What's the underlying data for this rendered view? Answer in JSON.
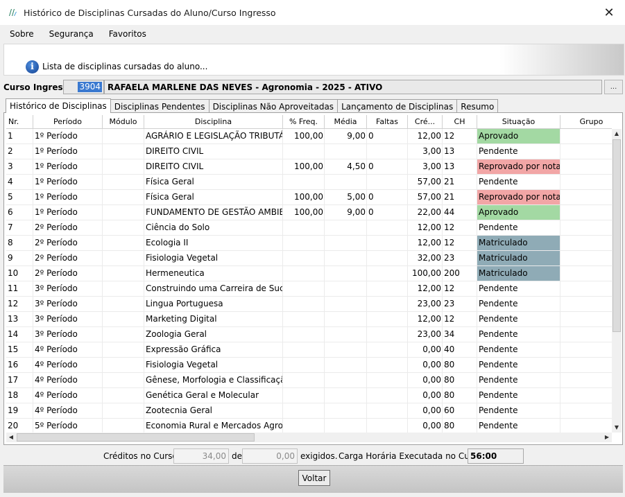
{
  "window": {
    "title": "Histórico de Disciplinas Cursadas do Aluno/Curso Ingresso",
    "close_symbol": "✕"
  },
  "menu": [
    "Sobre",
    "Segurança",
    "Favoritos"
  ],
  "info": {
    "icon_letter": "i",
    "text": "Lista de disciplinas cursadas do aluno..."
  },
  "curso": {
    "label": "Curso Ingresso:",
    "code": "3904",
    "name": "RAFAELA MARLENE DAS NEVES - Agronomia - 2025 - ATIVO",
    "lookup_label": "..."
  },
  "tabs": [
    "Histórico de Disciplinas",
    "Disciplinas Pendentes",
    "Disciplinas Não Aproveitadas",
    "Lançamento de Disciplinas",
    "Resumo"
  ],
  "grid": {
    "columns": [
      "Nr.",
      "Período",
      "Módulo",
      "Disciplina",
      "% Freq.",
      "Média",
      "Faltas",
      "Cré...",
      "CH",
      "Situação",
      "Grupo"
    ],
    "status_colors": {
      "Aprovado": "#a3d9a3",
      "Reprovado por nota": "#f2a6a6",
      "Matriculado": "#8fabb6",
      "Pendente": "#ffffff"
    },
    "rows": [
      {
        "nr": "1",
        "periodo": "1º Período",
        "modulo": "",
        "disciplina": "AGRÁRIO E LEGISLAÇÃO TRIBUTÁRIA",
        "freq": "100,00",
        "media": "9,00",
        "faltas": "0",
        "creditos": "12,00",
        "ch": "12",
        "situacao": "Aprovado",
        "grupo": ""
      },
      {
        "nr": "2",
        "periodo": "1º Período",
        "modulo": "",
        "disciplina": "DIREITO CIVIL",
        "freq": "",
        "media": "",
        "faltas": "",
        "creditos": "3,00",
        "ch": "13",
        "situacao": "Pendente",
        "grupo": ""
      },
      {
        "nr": "3",
        "periodo": "1º Período",
        "modulo": "",
        "disciplina": "DIREITO CIVIL",
        "freq": "100,00",
        "media": "4,50",
        "faltas": "0",
        "creditos": "3,00",
        "ch": "13",
        "situacao": "Reprovado por nota",
        "grupo": ""
      },
      {
        "nr": "4",
        "periodo": "1º Período",
        "modulo": "",
        "disciplina": "Física Geral",
        "freq": "",
        "media": "",
        "faltas": "",
        "creditos": "57,00",
        "ch": "21",
        "situacao": "Pendente",
        "grupo": ""
      },
      {
        "nr": "5",
        "periodo": "1º Período",
        "modulo": "",
        "disciplina": "Física Geral",
        "freq": "100,00",
        "media": "5,00",
        "faltas": "0",
        "creditos": "57,00",
        "ch": "21",
        "situacao": "Reprovado por nota",
        "grupo": ""
      },
      {
        "nr": "6",
        "periodo": "1º Período",
        "modulo": "",
        "disciplina": "FUNDAMENTO DE GESTÃO AMBIE...",
        "freq": "100,00",
        "media": "9,00",
        "faltas": "0",
        "creditos": "22,00",
        "ch": "44",
        "situacao": "Aprovado",
        "grupo": ""
      },
      {
        "nr": "7",
        "periodo": "2º Período",
        "modulo": "",
        "disciplina": "Ciência do Solo",
        "freq": "",
        "media": "",
        "faltas": "",
        "creditos": "12,00",
        "ch": "12",
        "situacao": "Pendente",
        "grupo": ""
      },
      {
        "nr": "8",
        "periodo": "2º Período",
        "modulo": "",
        "disciplina": "Ecologia II",
        "freq": "",
        "media": "",
        "faltas": "",
        "creditos": "12,00",
        "ch": "12",
        "situacao": "Matriculado",
        "grupo": ""
      },
      {
        "nr": "9",
        "periodo": "2º Período",
        "modulo": "",
        "disciplina": "Fisiologia Vegetal",
        "freq": "",
        "media": "",
        "faltas": "",
        "creditos": "32,00",
        "ch": "23",
        "situacao": "Matriculado",
        "grupo": ""
      },
      {
        "nr": "10",
        "periodo": "2º Período",
        "modulo": "",
        "disciplina": "Hermeneutica",
        "freq": "",
        "media": "",
        "faltas": "",
        "creditos": "100,00",
        "ch": "200",
        "situacao": "Matriculado",
        "grupo": ""
      },
      {
        "nr": "11",
        "periodo": "3º Período",
        "modulo": "",
        "disciplina": "Construindo uma Carreira de Suces...",
        "freq": "",
        "media": "",
        "faltas": "",
        "creditos": "12,00",
        "ch": "12",
        "situacao": "Pendente",
        "grupo": ""
      },
      {
        "nr": "12",
        "periodo": "3º Período",
        "modulo": "",
        "disciplina": "Lingua Portuguesa",
        "freq": "",
        "media": "",
        "faltas": "",
        "creditos": "23,00",
        "ch": "23",
        "situacao": "Pendente",
        "grupo": ""
      },
      {
        "nr": "13",
        "periodo": "3º Período",
        "modulo": "",
        "disciplina": "Marketing Digital",
        "freq": "",
        "media": "",
        "faltas": "",
        "creditos": "12,00",
        "ch": "12",
        "situacao": "Pendente",
        "grupo": ""
      },
      {
        "nr": "14",
        "periodo": "3º Período",
        "modulo": "",
        "disciplina": "Zoologia Geral",
        "freq": "",
        "media": "",
        "faltas": "",
        "creditos": "23,00",
        "ch": "34",
        "situacao": "Pendente",
        "grupo": ""
      },
      {
        "nr": "15",
        "periodo": "4º Período",
        "modulo": "",
        "disciplina": "Expressão Gráfica",
        "freq": "",
        "media": "",
        "faltas": "",
        "creditos": "0,00",
        "ch": "40",
        "situacao": "Pendente",
        "grupo": ""
      },
      {
        "nr": "16",
        "periodo": "4º Período",
        "modulo": "",
        "disciplina": "Fisiologia Vegetal",
        "freq": "",
        "media": "",
        "faltas": "",
        "creditos": "0,00",
        "ch": "80",
        "situacao": "Pendente",
        "grupo": ""
      },
      {
        "nr": "17",
        "periodo": "4º Período",
        "modulo": "",
        "disciplina": "Gênese, Morfologia e Classificação ...",
        "freq": "",
        "media": "",
        "faltas": "",
        "creditos": "0,00",
        "ch": "80",
        "situacao": "Pendente",
        "grupo": ""
      },
      {
        "nr": "18",
        "periodo": "4º Período",
        "modulo": "",
        "disciplina": "Genética Geral e Molecular",
        "freq": "",
        "media": "",
        "faltas": "",
        "creditos": "0,00",
        "ch": "80",
        "situacao": "Pendente",
        "grupo": ""
      },
      {
        "nr": "19",
        "periodo": "4º Período",
        "modulo": "",
        "disciplina": "Zootecnia Geral",
        "freq": "",
        "media": "",
        "faltas": "",
        "creditos": "0,00",
        "ch": "60",
        "situacao": "Pendente",
        "grupo": ""
      },
      {
        "nr": "20",
        "periodo": "5º Período",
        "modulo": "",
        "disciplina": "Economia Rural e Mercados Agrop...",
        "freq": "",
        "media": "",
        "faltas": "",
        "creditos": "0,00",
        "ch": "80",
        "situacao": "Pendente",
        "grupo": ""
      }
    ]
  },
  "summary": {
    "creditos_label": "Créditos no Curso:",
    "creditos_value": "34,00",
    "de_label": "de",
    "exigidos_value": "0,00",
    "exigidos_label": "exigidos.",
    "carga_label": "Carga Horária Executada no Curso:",
    "carga_value": "56:00"
  },
  "footer": {
    "voltar_label": "Voltar"
  },
  "scroll": {
    "up": "▲",
    "down": "▼",
    "left": "◀",
    "right": "▶"
  }
}
